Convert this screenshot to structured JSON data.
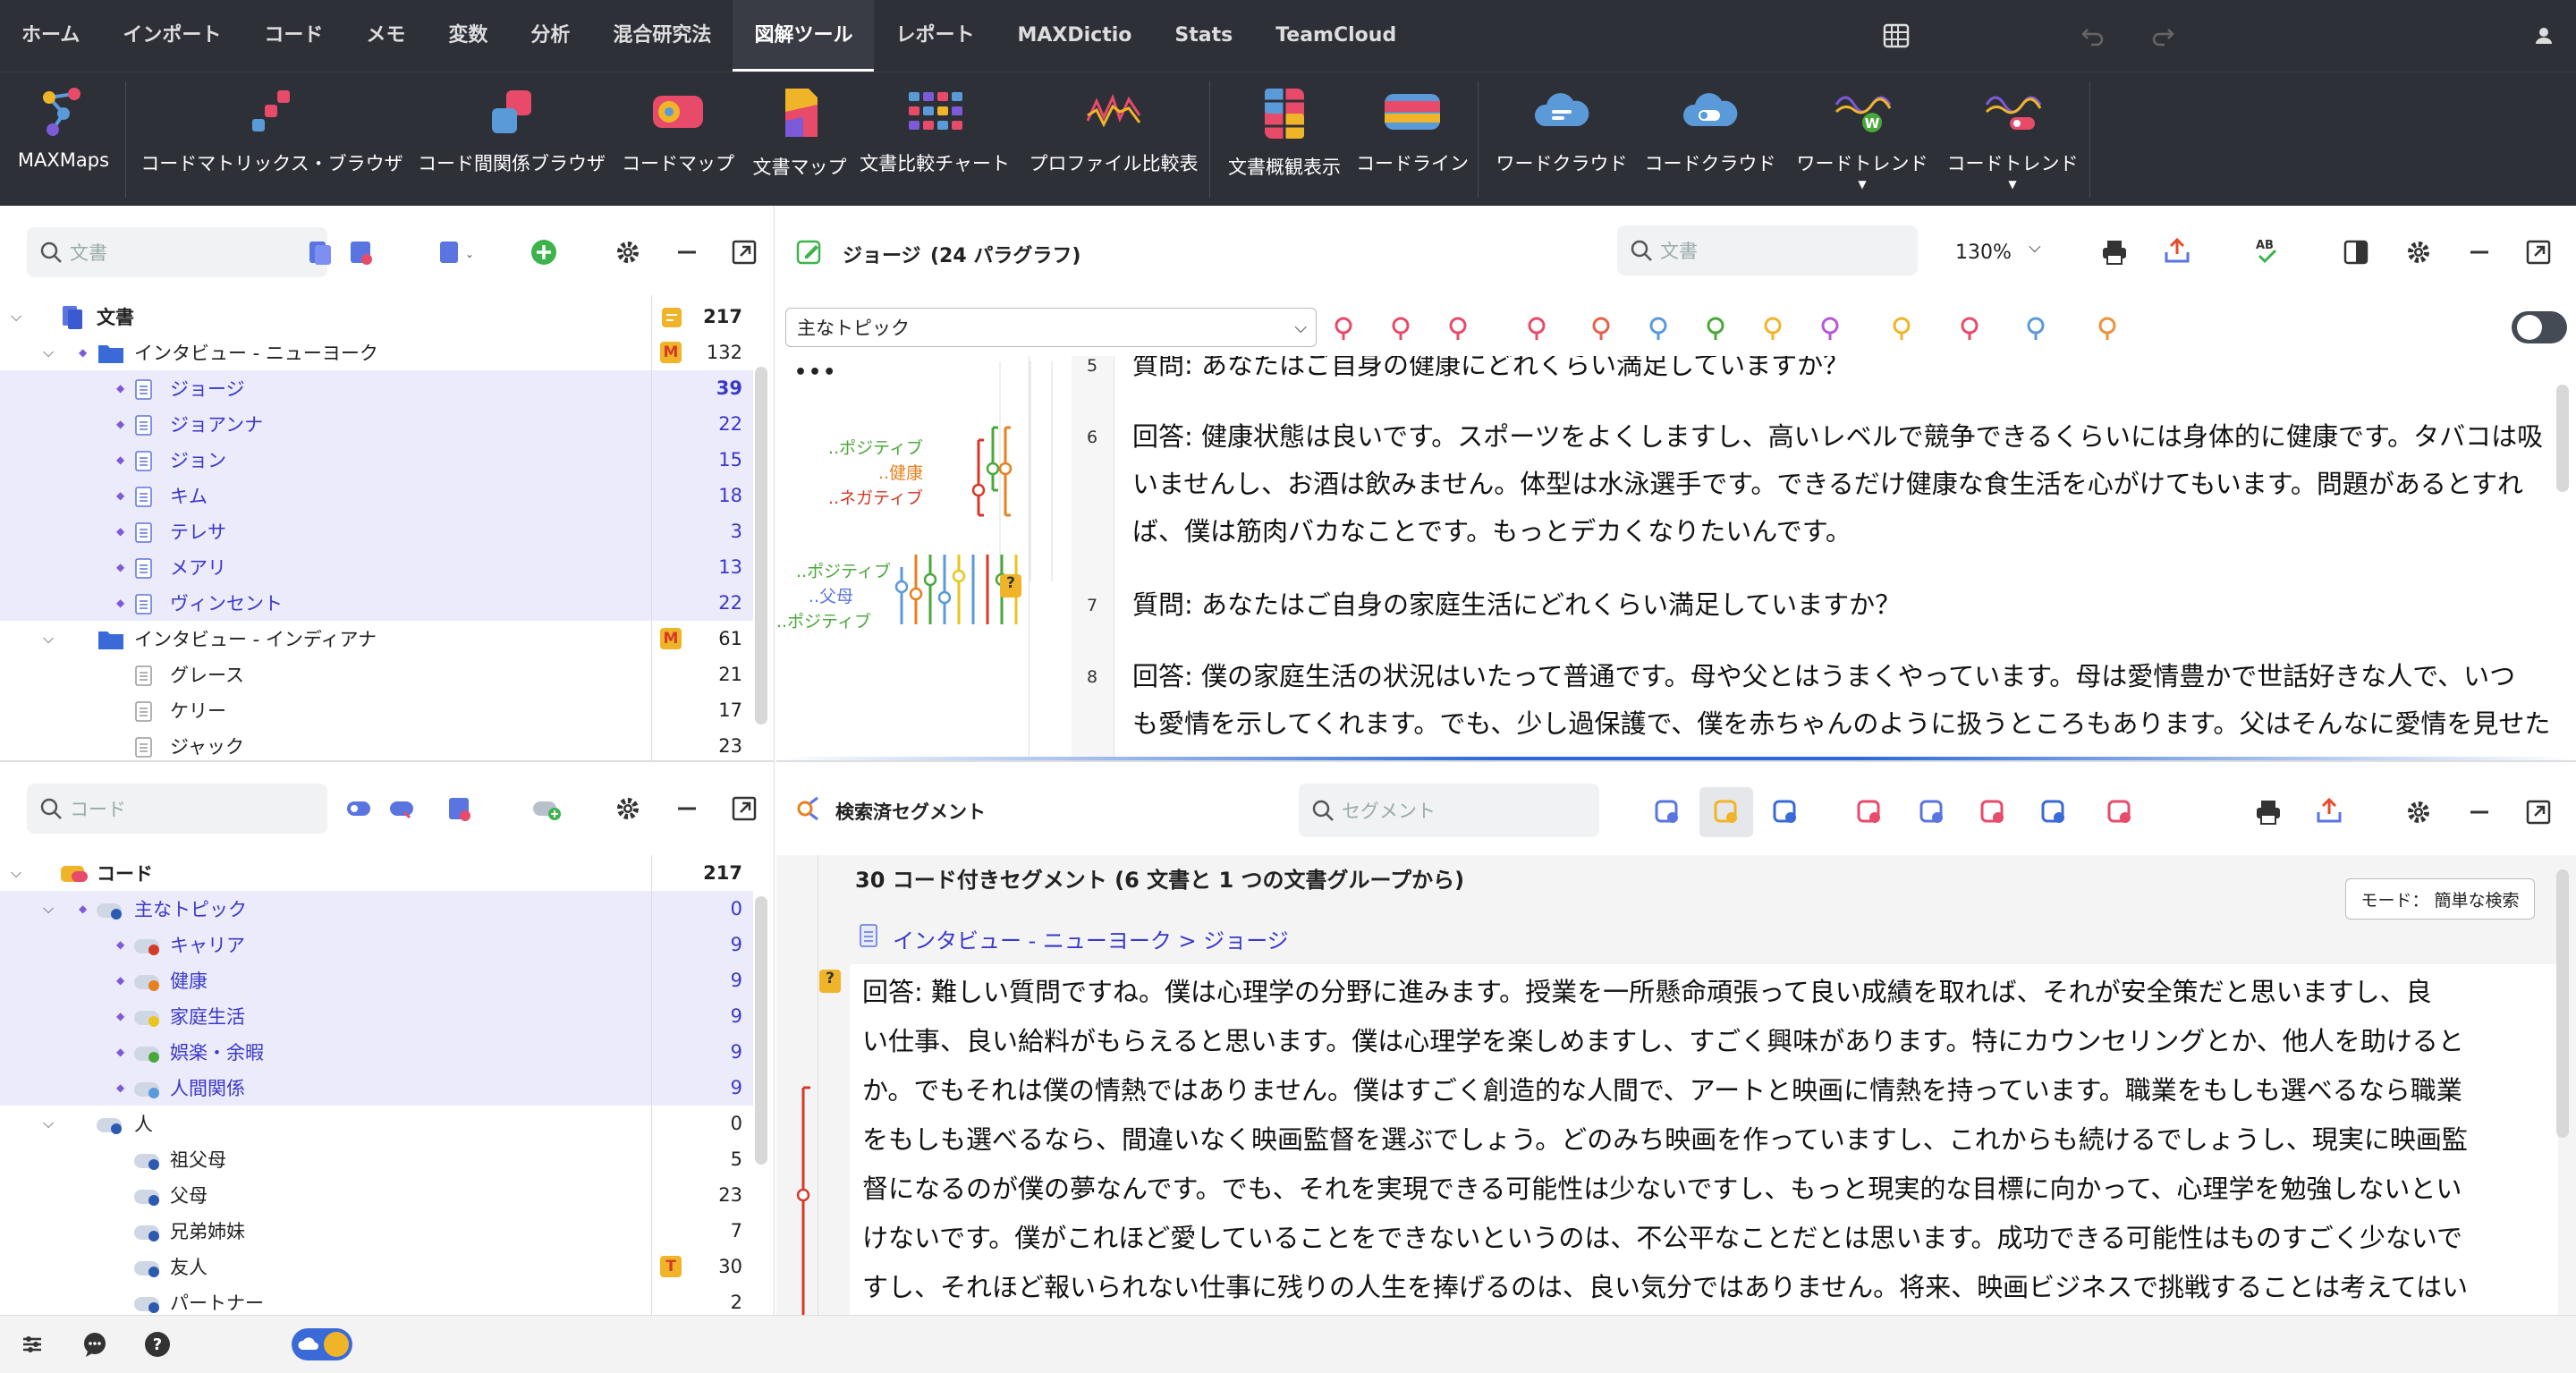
{
  "top_menu": [
    "ホーム",
    "インポート",
    "コード",
    "メモ",
    "変数",
    "分析",
    "混合研究法",
    "図解ツール",
    "レポート",
    "MAXDictio",
    "Stats",
    "TeamCloud"
  ],
  "active_menu": "図解ツール",
  "ribbon": {
    "maxmaps": "MAXMaps",
    "code_matrix": "コードマトリックス・ブラウザ",
    "code_relations": "コード間関係ブラウザ",
    "code_map": "コードマップ",
    "doc_map": "文書マップ",
    "doc_compare": "文書比較チャート",
    "profile_compare": "プロファイル比較表",
    "doc_portrait": "文書概観表示",
    "codeline": "コードライン",
    "word_cloud": "ワードクラウド",
    "code_cloud": "コードクラウド",
    "word_trend": "ワードトレンド",
    "code_trend": "コードトレンド"
  },
  "doc_panel": {
    "search_placeholder": "文書",
    "root": {
      "label": "文書",
      "count": "217"
    },
    "groups": [
      {
        "label": "インタビュー - ニューヨーク",
        "count": "132",
        "memo": "M",
        "docs": [
          {
            "label": "ジョージ",
            "count": "39"
          },
          {
            "label": "ジョアンナ",
            "count": "22"
          },
          {
            "label": "ジョン",
            "count": "15"
          },
          {
            "label": "キム",
            "count": "18"
          },
          {
            "label": "テレサ",
            "count": "3"
          },
          {
            "label": "メアリ",
            "count": "13"
          },
          {
            "label": "ヴィンセント",
            "count": "22"
          }
        ]
      },
      {
        "label": "インタビュー - インディアナ",
        "count": "61",
        "memo": "M",
        "docs": [
          {
            "label": "グレース",
            "count": "21"
          },
          {
            "label": "ケリー",
            "count": "17"
          },
          {
            "label": "ジャック",
            "count": "23"
          }
        ]
      }
    ]
  },
  "code_panel": {
    "search_placeholder": "コード",
    "root": {
      "label": "コード",
      "count": "217"
    },
    "main_topic": {
      "label": "主なトピック",
      "count": "0"
    },
    "topics": [
      {
        "label": "キャリア",
        "count": "9",
        "color": "#d43a2a"
      },
      {
        "label": "健康",
        "count": "9",
        "color": "#e8801f"
      },
      {
        "label": "家庭生活",
        "count": "9",
        "color": "#e8c61f"
      },
      {
        "label": "娯楽・余暇",
        "count": "9",
        "color": "#4aa83a"
      },
      {
        "label": "人間関係",
        "count": "9",
        "color": "#5a9ad8"
      }
    ],
    "people": {
      "label": "人",
      "count": "0"
    },
    "people_items": [
      {
        "label": "祖父母",
        "count": "5"
      },
      {
        "label": "父母",
        "count": "23"
      },
      {
        "label": "兄弟姉妹",
        "count": "7"
      },
      {
        "label": "友人",
        "count": "30",
        "memo": "T"
      },
      {
        "label": "パートナー",
        "count": "2"
      }
    ]
  },
  "browser": {
    "title": "ジョージ",
    "paragraphs_label": "(24 パラグラフ)",
    "search_placeholder": "文書",
    "zoom": "130%",
    "code_select": "主なトピック",
    "paragraphs": [
      {
        "num": "5",
        "lines": [
          "質問: あなたはご自身の健康にどれくらい満足していますか？"
        ]
      },
      {
        "num": "6",
        "lines": [
          "回答: 健康状態は良いです。スポーツをよくしますし、高いレベルで競争できるくらいには身体的に健康です。タバコは吸",
          "いませんし、お酒は飲みません。体型は水泳選手です。できるだけ健康な食生活を心がけてもいます。問題があるとすれ",
          "ば、僕は筋肉バカなことです。もっとデカくなりたいんです。"
        ]
      },
      {
        "num": "7",
        "lines": [
          "質問: あなたはご自身の家庭生活にどれくらい満足していますか？"
        ]
      },
      {
        "num": "8",
        "lines": [
          "回答: 僕の家庭生活の状況はいたって普通です。母や父とはうまくやっています。母は愛情豊かで世話好きな人で、いつ",
          "も愛情を示してくれます。でも、少し過保護で、僕を赤ちゃんのように扱うところもあります。父はそんなに愛情を見せた"
        ]
      }
    ],
    "code_labels": {
      "p6": [
        "..ポジティブ",
        "..健康",
        "..ネガティブ"
      ],
      "p8": [
        "..ポジティブ",
        "..父母",
        "..ポジティブ"
      ]
    },
    "memo_badge": "?"
  },
  "retrieved": {
    "title": "検索済セグメント",
    "search_placeholder": "セグメント",
    "summary": "30 コード付きセグメント (6 文書と 1 つの文書グループから)",
    "mode": "モード： 簡単な検索",
    "path": "インタビュー - ニューヨーク > ジョージ",
    "memo_badge": "?",
    "segment_lines": [
      "回答: 難しい質問ですね。僕は心理学の分野に進みます。授業を一所懸命頑張って良い成績を取れば、それが安全策だと思いますし、良",
      "い仕事、良い給料がもらえると思います。僕は心理学を楽しめますし、すごく興味があります。特にカウンセリングとか、他人を助けると",
      "か。でもそれは僕の情熱ではありません。僕はすごく創造的な人間で、アートと映画に情熱を持っています。職業をもしも選べるなら職業",
      "をもしも選べるなら、間違いなく映画監督を選ぶでしょう。どのみち映画を作っていますし、これからも続けるでしょうし、現実に映画監",
      "督になるのが僕の夢なんです。でも、それを実現できる可能性は少ないですし、もっと現実的な目標に向かって、心理学を勉強しないとい",
      "けないです。僕がこれほど愛していることをできないというのは、不公平なことだとは思います。成功できる可能性はものすごく少ないで",
      "すし、それほど報いられない仕事に残りの人生を捧げるのは、良い気分ではありません。将来、映画ビジネスで挑戦することは考えてはい"
    ]
  },
  "colors": {
    "accent": "#3a38c8",
    "dark": "#2e3038",
    "selection": "#ecebfb"
  }
}
